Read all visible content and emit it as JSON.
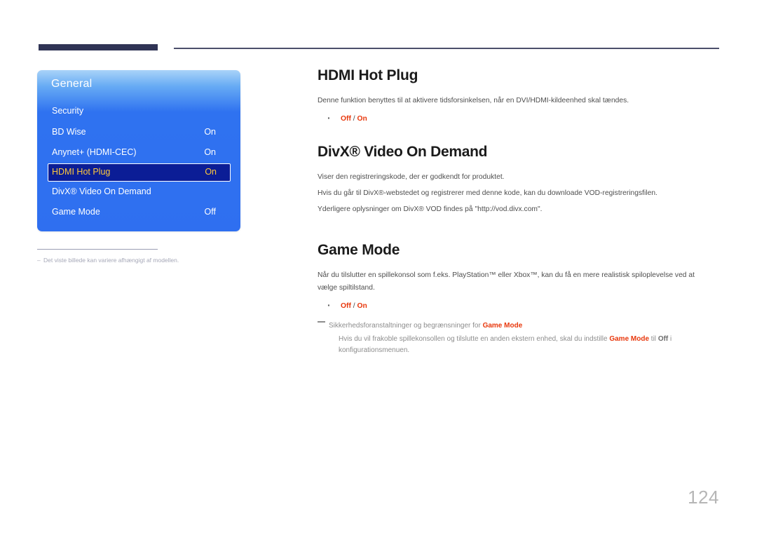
{
  "page": {
    "number": "124",
    "language": "da"
  },
  "osd": {
    "title": "General",
    "rows": [
      {
        "label": "Security",
        "value": "",
        "selected": false
      },
      {
        "label": "BD Wise",
        "value": "On",
        "selected": false
      },
      {
        "label": "Anynet+ (HDMI-CEC)",
        "value": "On",
        "selected": false
      },
      {
        "label": "HDMI Hot Plug",
        "value": "On",
        "selected": true
      },
      {
        "label": "DivX® Video On Demand",
        "value": "",
        "selected": false
      },
      {
        "label": "Game Mode",
        "value": "Off",
        "selected": false
      }
    ],
    "footnote": {
      "dash": "–",
      "text": "Det viste billede kan variere afhængigt af modellen."
    },
    "colors": {
      "panel_top": "#a9d3f8",
      "panel_bottom": "#2f6ff0",
      "selected_bg": "#0b1d96",
      "selected_text": "#ffc83c",
      "header_bar": "#303455"
    }
  },
  "sections": [
    {
      "heading": "HDMI Hot Plug",
      "paragraphs": [
        "Denne funktion benyttes til at aktivere tidsforsinkelsen, når en DVI/HDMI-kildeenhed skal tændes."
      ],
      "options": {
        "off": "Off",
        "sep": " / ",
        "on": "On"
      }
    },
    {
      "heading": "DivX® Video On Demand",
      "paragraphs": [
        "Viser den registreringskode, der er godkendt for produktet.",
        "Hvis du går til DivX®-webstedet og registrerer med denne kode, kan du downloade VOD-registreringsfilen.",
        "Yderligere oplysninger om DivX® VOD findes på \"http://vod.divx.com\"."
      ],
      "options": null
    },
    {
      "heading": "Game Mode",
      "paragraphs": [
        "Når du tilslutter en spillekonsol som f.eks. PlayStation™ eller Xbox™, kan du få en mere realistisk spiloplevelse ved at vælge spiltilstand."
      ],
      "options": {
        "off": "Off",
        "sep": " / ",
        "on": "On"
      }
    }
  ],
  "caution": {
    "head_prefix": "Sikkerhedsforanstaltninger og begrænsninger for ",
    "head_term": "Game Mode",
    "body_1": "Hvis du vil frakoble spillekonsollen og tilslutte en anden ekstern enhed, skal du indstille ",
    "body_term_1": "Game Mode",
    "body_2": " til ",
    "body_term_2": "Off",
    "body_3": " i konfigurationsmenuen."
  }
}
